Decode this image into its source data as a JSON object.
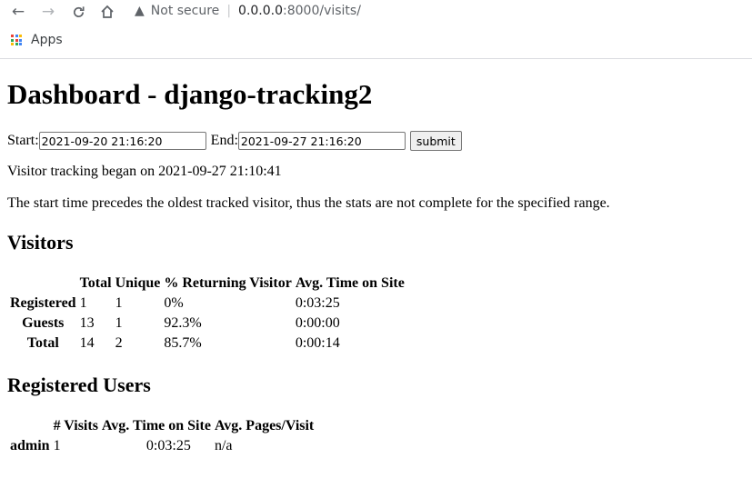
{
  "browser": {
    "security_label": "Not secure",
    "url_host": "0.0.0.0",
    "url_path": ":8000/visits/",
    "bookmarks": {
      "apps_label": "Apps"
    }
  },
  "page": {
    "title": "Dashboard - django-tracking2",
    "form": {
      "start_label": "Start:",
      "start_value": "2021-09-20 21:16:20",
      "end_label": "End:",
      "end_value": "2021-09-27 21:16:20",
      "submit_label": "submit"
    },
    "tracking_began": "Visitor tracking began on 2021-09-27 21:10:41",
    "warning": "The start time precedes the oldest tracked visitor, thus the stats are not complete for the specified range.",
    "visitors": {
      "heading": "Visitors",
      "columns": [
        "Total",
        "Unique",
        "% Returning Visitor",
        "Avg. Time on Site"
      ],
      "rows": [
        {
          "label": "Registered",
          "total": "1",
          "unique": "1",
          "returning": "0%",
          "avg_time": "0:03:25"
        },
        {
          "label": "Guests",
          "total": "13",
          "unique": "1",
          "returning": "92.3%",
          "avg_time": "0:00:00"
        },
        {
          "label": "Total",
          "total": "14",
          "unique": "2",
          "returning": "85.7%",
          "avg_time": "0:00:14"
        }
      ]
    },
    "registered_users": {
      "heading": "Registered Users",
      "columns": [
        "# Visits",
        "Avg. Time on Site",
        "Avg. Pages/Visit"
      ],
      "rows": [
        {
          "user": "admin",
          "visits": "1",
          "avg_time": "0:03:25",
          "pages_per_visit": "n/a"
        }
      ]
    }
  }
}
